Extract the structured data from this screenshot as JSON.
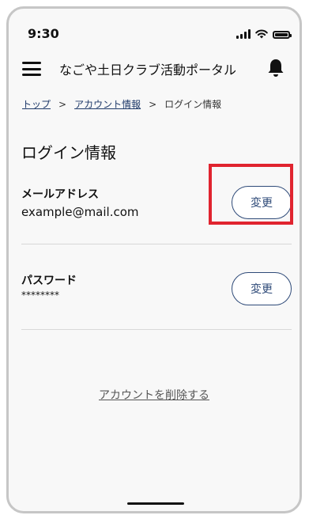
{
  "status_bar": {
    "time": "9:30"
  },
  "app_bar": {
    "title": "なごや土日クラブ活動ポータル"
  },
  "breadcrumb": {
    "items": [
      "トップ",
      "アカウント情報"
    ],
    "current": "ログイン情報",
    "separator": ">"
  },
  "page": {
    "title": "ログイン情報"
  },
  "email": {
    "label": "メールアドレス",
    "value": "example@mail.com",
    "button_label": "変更"
  },
  "password": {
    "label": "パスワード",
    "value": "********",
    "button_label": "変更"
  },
  "delete_account": {
    "label": "アカウントを削除する"
  },
  "colors": {
    "accent": "#2e4a78",
    "highlight": "#e0242f"
  }
}
